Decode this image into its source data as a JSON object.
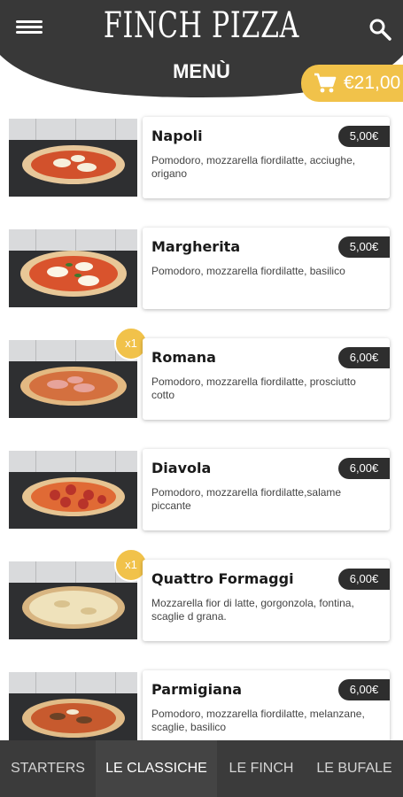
{
  "header": {
    "logo": "FINCH PIZZA",
    "title": "MENÙ",
    "menu_icon": "hamburger-menu-icon",
    "search_icon": "search-icon"
  },
  "cart": {
    "icon": "shopping-cart-icon",
    "total": "€21,00",
    "color": "#f1c24a"
  },
  "items": [
    {
      "name": "Napoli",
      "price": "5,00€",
      "description": "Pomodoro, mozzarella fiordilatte, acciughe, origano",
      "qty": ""
    },
    {
      "name": "Margherita",
      "price": "5,00€",
      "description": "Pomodoro, mozzarella fiordilatte, basilico",
      "qty": ""
    },
    {
      "name": "Romana",
      "price": "6,00€",
      "description": "Pomodoro, mozzarella fiordilatte, prosciutto cotto",
      "qty": "x1"
    },
    {
      "name": "Diavola",
      "price": "6,00€",
      "description": "Pomodoro, mozzarella fiordilatte,salame piccante",
      "qty": ""
    },
    {
      "name": "Quattro Formaggi",
      "price": "6,00€",
      "description": "Mozzarella fior di latte, gorgonzola, fontina, scaglie d grana.",
      "qty": "x1"
    },
    {
      "name": "Parmigiana",
      "price": "6,00€",
      "description": "Pomodoro, mozzarella fiordilatte, melanzane, scaglie, basilico",
      "qty": ""
    }
  ],
  "tabs": [
    {
      "label": "STARTERS",
      "active": false
    },
    {
      "label": "LE CLASSICHE",
      "active": true
    },
    {
      "label": "LE FINCH",
      "active": false
    },
    {
      "label": "LE BUFALE",
      "active": false
    }
  ],
  "colors": {
    "header": "#383838",
    "accent": "#f1c24a",
    "price_badge": "#2e2e2e",
    "tab_bar": "#3b3b3b"
  }
}
